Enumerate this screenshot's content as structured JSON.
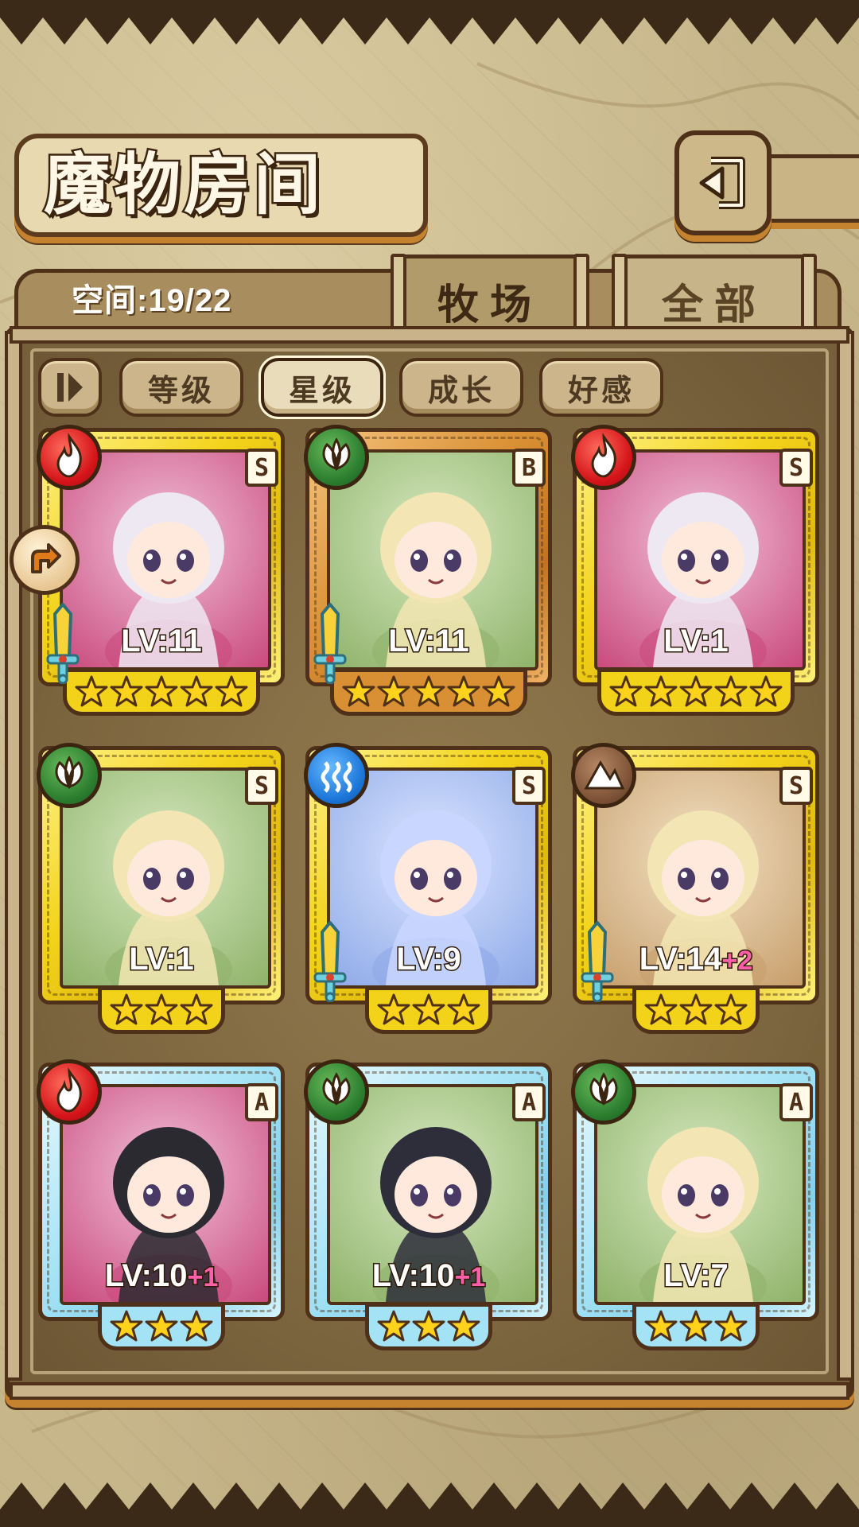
{
  "header": {
    "title": "魔物房间",
    "back_icon": "back-arrow-icon"
  },
  "tabs": {
    "space_label": "空间:19/22",
    "items": [
      {
        "label": "牧场",
        "active": true
      },
      {
        "label": "全部",
        "active": false
      }
    ]
  },
  "filters": {
    "toggle_icon": "sort-toggle-icon",
    "items": [
      {
        "label": "等级",
        "active": false
      },
      {
        "label": "星级",
        "active": true
      },
      {
        "label": "成长",
        "active": false
      },
      {
        "label": "好感",
        "active": false
      }
    ]
  },
  "colors": {
    "gold": "#f3d31a",
    "bronze": "#d98f33",
    "blue": "#a4e3f6",
    "fire": "#d4141a",
    "leaf": "#2b7d2f",
    "water": "#1b76d8",
    "earth": "#7d5337"
  },
  "monsters": [
    {
      "element": "fire",
      "grade": "S",
      "lv": "LV:11",
      "plus": "",
      "stars": 5,
      "rarity": "gold",
      "weapon": true
    },
    {
      "element": "leaf",
      "grade": "B",
      "lv": "LV:11",
      "plus": "",
      "stars": 5,
      "rarity": "bronze",
      "weapon": true
    },
    {
      "element": "fire",
      "grade": "S",
      "lv": "LV:1",
      "plus": "",
      "stars": 5,
      "rarity": "gold",
      "weapon": false
    },
    {
      "element": "leaf",
      "grade": "S",
      "lv": "LV:1",
      "plus": "",
      "stars": 3,
      "rarity": "gold",
      "weapon": false
    },
    {
      "element": "water",
      "grade": "S",
      "lv": "LV:9",
      "plus": "",
      "stars": 3,
      "rarity": "gold",
      "weapon": true
    },
    {
      "element": "earth",
      "grade": "S",
      "lv": "LV:14",
      "plus": "+2",
      "stars": 3,
      "rarity": "gold",
      "weapon": true
    },
    {
      "element": "fire",
      "grade": "A",
      "lv": "LV:10",
      "plus": "+1",
      "stars": 3,
      "rarity": "blue",
      "weapon": false
    },
    {
      "element": "leaf",
      "grade": "A",
      "lv": "LV:10",
      "plus": "+1",
      "stars": 3,
      "rarity": "blue",
      "weapon": false
    },
    {
      "element": "leaf",
      "grade": "A",
      "lv": "LV:7",
      "plus": "",
      "stars": 3,
      "rarity": "blue",
      "weapon": false
    }
  ]
}
